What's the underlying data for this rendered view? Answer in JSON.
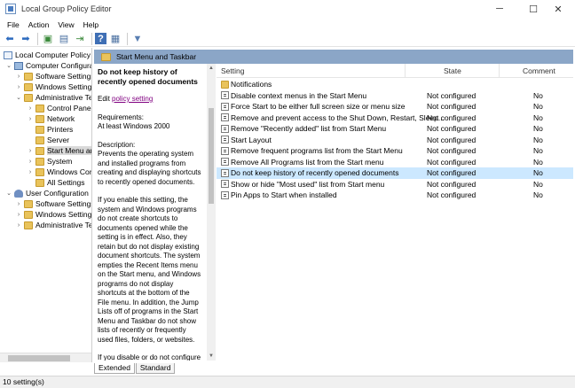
{
  "window": {
    "title": "Local Group Policy Editor",
    "minimize_icon": "minimize-icon",
    "maximize_icon": "maximize-icon",
    "close_icon": "close-icon",
    "minimize": "─",
    "maximize": "☐",
    "close": "✕"
  },
  "menubar": {
    "items": [
      "File",
      "Action",
      "View",
      "Help"
    ]
  },
  "toolbar": {
    "back": "⬅",
    "forward": "➡",
    "up": "▣",
    "show_hide": "▤",
    "export": "⇥",
    "help": "?",
    "properties": "▦",
    "filter": "▼"
  },
  "tree": {
    "root": "Local Computer Policy",
    "computer": "Computer Configura",
    "computer_software": "Software Settings",
    "computer_windows": "Windows Setting",
    "computer_admin": "Administrative Te",
    "control_panel": "Control Panel",
    "network": "Network",
    "printers": "Printers",
    "server": "Server",
    "start_menu": "Start Menu ar",
    "system": "System",
    "windows_components": "Windows Cor",
    "all_settings": "All Settings",
    "user": "User Configuration",
    "user_software": "Software Settings",
    "user_windows": "Windows Setting",
    "user_admin": "Administrative Te"
  },
  "header": {
    "title": "Start Menu and Taskbar"
  },
  "description": {
    "title": "Do not keep history of recently opened documents",
    "edit_prefix": "Edit",
    "edit_link": "policy setting",
    "requirements_label": "Requirements:",
    "requirements": "At least Windows 2000",
    "description_label": "Description:",
    "p1": "Prevents the operating system and installed programs from creating and displaying shortcuts to recently opened documents.",
    "p2": "If you enable this setting, the system and Windows programs do not create shortcuts to documents opened while the setting is in effect. Also, they retain but do not display existing document shortcuts. The system empties the Recent Items menu on the Start menu, and Windows programs do not display shortcuts at the bottom of the File menu. In addition, the Jump Lists off of programs in the Start Menu and Taskbar do not show lists of recently or frequently used files, folders, or websites.",
    "p3": "If you disable or do not configure this setting, the system will store and display shortcuts to recently"
  },
  "list": {
    "columns": {
      "setting": "Setting",
      "state": "State",
      "comment": "Comment"
    },
    "folder_row": "Notifications",
    "rows": [
      {
        "setting": "Disable context menus in the Start Menu",
        "state": "Not configured",
        "comment": "No"
      },
      {
        "setting": "Force Start to be either full screen size or menu size",
        "state": "Not configured",
        "comment": "No"
      },
      {
        "setting": "Remove and prevent access to the Shut Down, Restart, Sleep...",
        "state": "Not configured",
        "comment": "No"
      },
      {
        "setting": "Remove \"Recently added\" list from Start Menu",
        "state": "Not configured",
        "comment": "No"
      },
      {
        "setting": "Start Layout",
        "state": "Not configured",
        "comment": "No"
      },
      {
        "setting": "Remove frequent programs list from the Start Menu",
        "state": "Not configured",
        "comment": "No"
      },
      {
        "setting": "Remove All Programs list from the Start menu",
        "state": "Not configured",
        "comment": "No"
      },
      {
        "setting": "Do not keep history of recently opened documents",
        "state": "Not configured",
        "comment": "No"
      },
      {
        "setting": "Show or hide \"Most used\" list from Start menu",
        "state": "Not configured",
        "comment": "No"
      },
      {
        "setting": "Pin Apps to Start when installed",
        "state": "Not configured",
        "comment": "No"
      }
    ]
  },
  "tabs": {
    "extended": "Extended",
    "standard": "Standard"
  },
  "status": {
    "text": "10 setting(s)"
  }
}
